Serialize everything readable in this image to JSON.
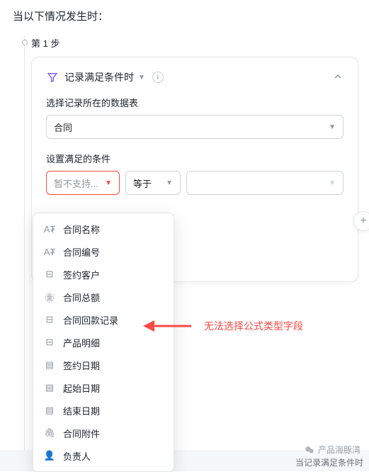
{
  "page": {
    "title": "当以下情况发生时：",
    "step_label": "第 1 步"
  },
  "card": {
    "title": "记录满足条件时",
    "table_label": "选择记录所在的数据表",
    "table_value": "合同",
    "condition_label": "设置满足的条件",
    "field_placeholder": "暂不支持...",
    "op_value": "等于"
  },
  "dropdown": {
    "items": [
      {
        "icon": "text-icon",
        "icon_glyph": "A₮",
        "label": "合同名称"
      },
      {
        "icon": "text-icon",
        "icon_glyph": "A₮",
        "label": "合同编号"
      },
      {
        "icon": "link-icon",
        "icon_glyph": "⊟",
        "label": "签约客户"
      },
      {
        "icon": "money-icon",
        "icon_glyph": "㊎",
        "label": "合同总额"
      },
      {
        "icon": "link-icon",
        "icon_glyph": "⊟",
        "label": "合同回款记录"
      },
      {
        "icon": "link-icon",
        "icon_glyph": "⊟",
        "label": "产品明细"
      },
      {
        "icon": "date-icon",
        "icon_glyph": "▤",
        "label": "签约日期"
      },
      {
        "icon": "date-icon",
        "icon_glyph": "▤",
        "label": "起始日期"
      },
      {
        "icon": "date-icon",
        "icon_glyph": "▤",
        "label": "结束日期"
      },
      {
        "icon": "attach-icon",
        "icon_glyph": "🖇",
        "label": "合同附件"
      },
      {
        "icon": "person-icon",
        "icon_glyph": "👤",
        "label": "负责人"
      }
    ]
  },
  "callout": {
    "text": "无法选择公式类型字段"
  },
  "footer": {
    "brand": "产品海豚湾",
    "bottom_caption": "当记录满足条件时"
  }
}
